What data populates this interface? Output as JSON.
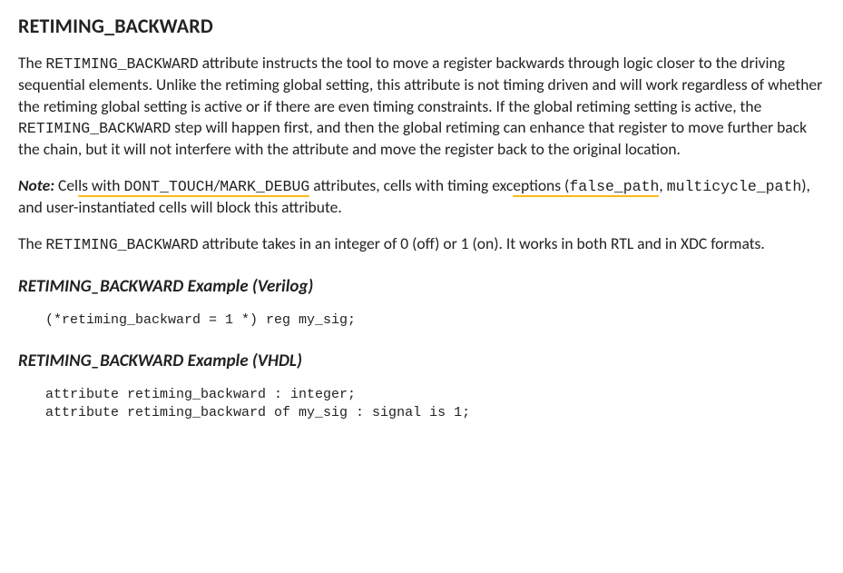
{
  "title": "RETIMING_BACKWARD",
  "p1_a": "The ",
  "p1_code1": "RETIMING_BACKWARD",
  "p1_b": " attribute instructs the tool to move a register backwards through logic closer to the driving sequential elements. Unlike the retiming global setting, this attribute is not timing driven and will work regardless of whether the retiming global setting is active or if there are even timing constraints. If the global retiming setting is active, the ",
  "p1_code2": "RETIMING_BACKWARD",
  "p1_c": " step will happen first, and then the global retiming can enhance that register to move further back the chain, but it will not interfere with the attribute and move the register back to the original location.",
  "note_label": "Note:",
  "note_a": "  Cel",
  "note_hl1": "ls with ",
  "note_code1": "DONT_TOUCH",
  "note_slash": "/",
  "note_code2": "MARK_DEBUG",
  "note_b": " attributes, cells with timing exc",
  "note_hl2": "eptions (",
  "note_code3": "false_path",
  "note_comma": ", ",
  "note_code4": "multicycle_path",
  "note_hl3": "), and user-instantiat",
  "note_c": "ed cells will block this attribute.",
  "p3_a": "The ",
  "p3_code1": "RETIMING_BACKWARD",
  "p3_b": " attribute takes in an integer of 0 (off) or 1 (on). It works in both RTL and in XDC formats.",
  "h2_verilog": "RETIMING_BACKWARD Example (Verilog)",
  "code_verilog": "(*retiming_backward = 1 *) reg my_sig;",
  "h2_vhdl": "RETIMING_BACKWARD Example (VHDL)",
  "code_vhdl": "attribute retiming_backward : integer;\nattribute retiming_backward of my_sig : signal is 1;"
}
